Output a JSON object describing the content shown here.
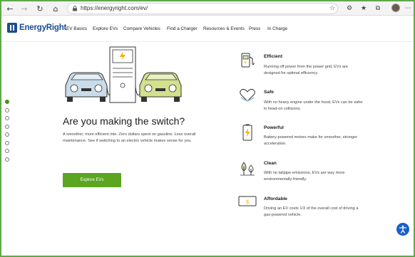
{
  "browser": {
    "url": "https://energyright.com/ev/"
  },
  "site": {
    "logo_text": "EnergyRight",
    "brand_color": "#1b4d8f",
    "accent_color": "#5ba521",
    "nav": [
      "EV Basics",
      "Explore EVs",
      "Compare Vehicles",
      "Find a Charger",
      "Resources & Events",
      "Press",
      "In Charge"
    ]
  },
  "hero": {
    "title": "Are you making the switch?",
    "text": "A smoother, more efficient ride. Zero dollars spent on gasoline. Less overall maintenance. See if switching to an electric vehicle makes sense for you.",
    "cta": "Explore EVs"
  },
  "pager": {
    "count": 8,
    "active_index": 0
  },
  "features": [
    {
      "icon": "fuel-pump-icon",
      "title": "Efficient",
      "desc": "Running off power from the power grid, EVs are designed for optimal efficiency."
    },
    {
      "icon": "heart-hands-icon",
      "title": "Safe",
      "desc": "With no heavy engine under the hood, EVs can be safer in head-on collisions."
    },
    {
      "icon": "battery-bolt-icon",
      "title": "Powerful",
      "desc": "Battery-powered motors make for smoother, stronger acceleration."
    },
    {
      "icon": "trees-icon",
      "title": "Clean",
      "desc": "With no tailpipe emissions, EVs are way more environmentally-friendly."
    },
    {
      "icon": "dollar-bill-icon",
      "title": "Affordable",
      "desc": "Driving an EV costs 1/3 of the overall cost of driving a gas-powered vehicle."
    }
  ]
}
